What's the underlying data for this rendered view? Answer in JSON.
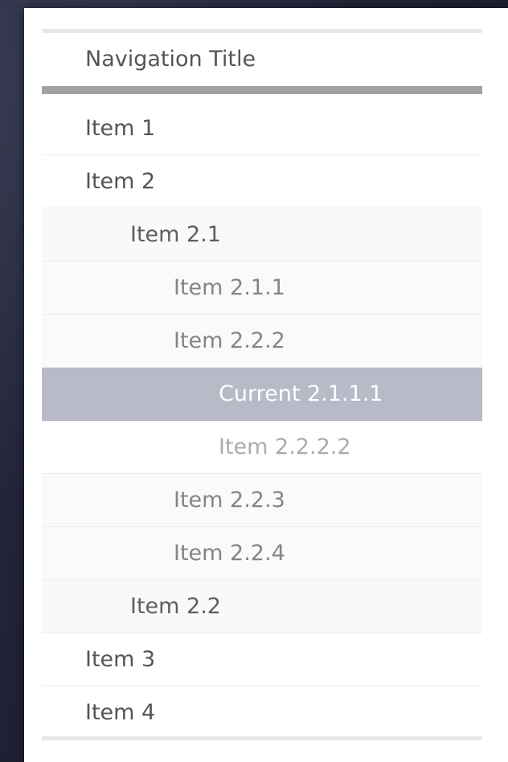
{
  "nav": {
    "title": "Navigation Title",
    "items": [
      {
        "label": "Item 1"
      },
      {
        "label": "Item 2"
      },
      {
        "label": "Item 2.1"
      },
      {
        "label": "Item 2.1.1"
      },
      {
        "label": "Item 2.2.2"
      },
      {
        "label": "Current 2.1.1.1"
      },
      {
        "label": "Item 2.2.2.2"
      },
      {
        "label": "Item 2.2.3"
      },
      {
        "label": "Item 2.2.4"
      },
      {
        "label": "Item 2.2"
      },
      {
        "label": "Item 3"
      },
      {
        "label": "Item 4"
      }
    ]
  },
  "colors": {
    "current_highlight": "#b8bac8",
    "title_divider": "#a2a2a2",
    "background": "#23263a"
  }
}
